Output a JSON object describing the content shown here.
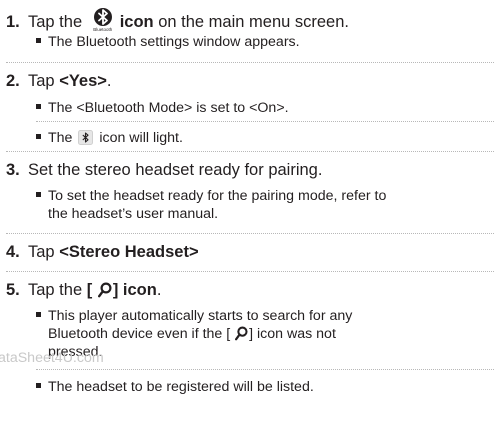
{
  "steps": [
    {
      "number": "1.",
      "pre": "Tap the ",
      "icon_name": "bluetooth-icon",
      "icon_caption": "Bluetooth",
      "bold": "icon",
      "post": " on the main menu screen.",
      "bullets": [
        "The Bluetooth settings window appears."
      ]
    },
    {
      "number": "2.",
      "pre": "Tap ",
      "bold": "<Yes>",
      "post": ".",
      "bullets": [
        "The <Bluetooth Mode> is set to <On>."
      ],
      "bullet_icon_line": {
        "pre": "The ",
        "icon_name": "bluetooth-small-icon",
        "post": " icon will light."
      }
    },
    {
      "number": "3.",
      "text": "Set the stereo headset ready for pairing.",
      "bullet_lines": [
        "To set the headset ready for the pairing mode, refer to",
        "the headset’s user manual."
      ]
    },
    {
      "number": "4.",
      "pre": "Tap ",
      "bold": "<Stereo Headset>"
    },
    {
      "number": "5.",
      "pre": "Tap the ",
      "bold_open": "[ ",
      "icon_name": "search-icon",
      "bold_close": "] icon",
      "post": ".",
      "bullet_lines": [
        "This player automatically starts to search for any",
        "Bluetooth device even if the [ ",
        "] icon was not",
        "pressed."
      ],
      "bullet_last": "The headset to be registered will be listed."
    }
  ],
  "watermark": "ataSheet4U.com"
}
